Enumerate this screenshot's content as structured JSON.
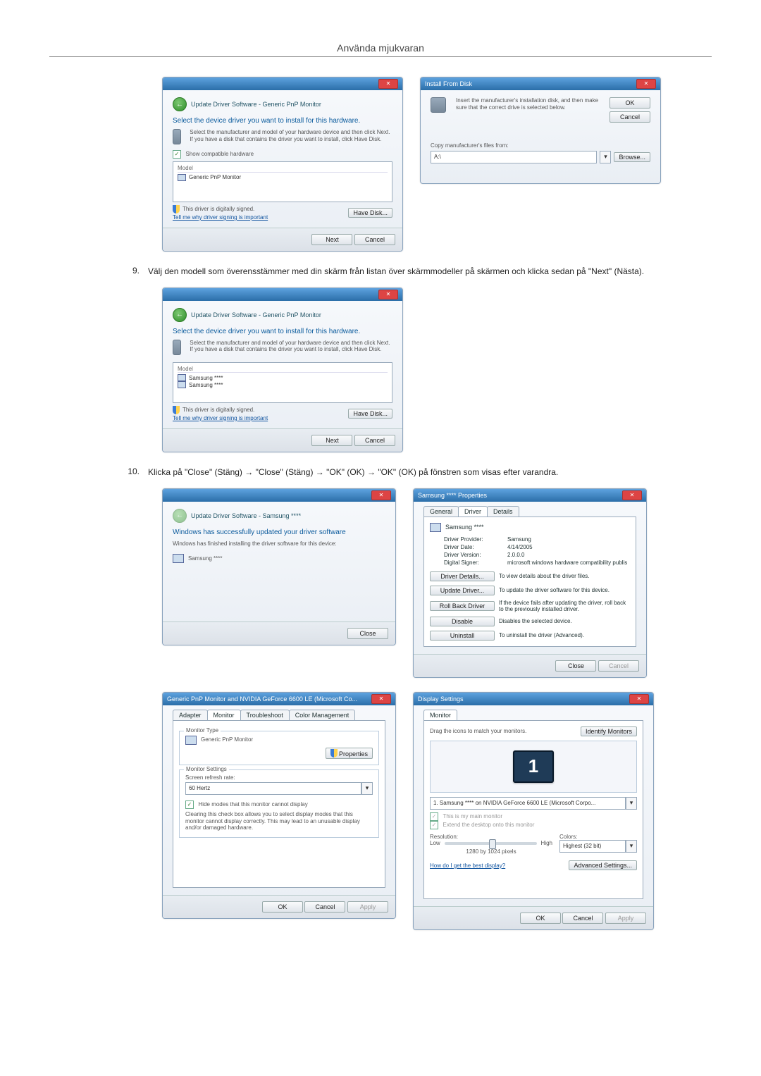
{
  "page_title": "Använda mjukvaran",
  "step9": {
    "num": "9.",
    "text": "Välj den modell som överensstämmer med din skärm från listan över skärmmodeller på skärmen och klicka sedan på \"Next\" (Nästa)."
  },
  "step10": {
    "num": "10.",
    "text": "Klicka på \"Close\" (Stäng) → \"Close\" (Stäng) → \"OK\" (OK) → \"OK\" (OK) på fönstren som visas efter varandra."
  },
  "fig1": {
    "crumb": "Update Driver Software - Generic PnP Monitor",
    "heading": "Select the device driver you want to install for this hardware.",
    "desc": "Select the manufacturer and model of your hardware device and then click Next. If you have a disk that contains the driver you want to install, click Have Disk.",
    "show_compat": "Show compatible hardware",
    "col_model": "Model",
    "item1": "Generic PnP Monitor",
    "signed": "This driver is digitally signed.",
    "tell": "Tell me why driver signing is important",
    "have_disk": "Have Disk...",
    "next": "Next",
    "cancel": "Cancel"
  },
  "fig2": {
    "title": "Install From Disk",
    "desc": "Insert the manufacturer's installation disk, and then make sure that the correct drive is selected below.",
    "ok": "OK",
    "cancel": "Cancel",
    "copy": "Copy manufacturer's files from:",
    "drive": "A:\\",
    "browse": "Browse..."
  },
  "fig3": {
    "crumb": "Update Driver Software - Generic PnP Monitor",
    "heading": "Select the device driver you want to install for this hardware.",
    "desc": "Select the manufacturer and model of your hardware device and then click Next. If you have a disk that contains the driver you want to install, click Have Disk.",
    "col_model": "Model",
    "item1": "Samsung ****",
    "item2": "Samsung ****",
    "signed": "This driver is digitally signed.",
    "tell": "Tell me why driver signing is important",
    "have_disk": "Have Disk...",
    "next": "Next",
    "cancel": "Cancel"
  },
  "fig4": {
    "crumb": "Update Driver Software - Samsung ****",
    "heading": "Windows has successfully updated your driver software",
    "desc": "Windows has finished installing the driver software for this device:",
    "item": "Samsung ****",
    "close": "Close"
  },
  "fig5": {
    "title": "Samsung **** Properties",
    "tabs": {
      "general": "General",
      "driver": "Driver",
      "details": "Details"
    },
    "device": "Samsung ****",
    "rows": {
      "prov_l": "Driver Provider:",
      "prov_v": "Samsung",
      "date_l": "Driver Date:",
      "date_v": "4/14/2005",
      "ver_l": "Driver Version:",
      "ver_v": "2.0.0.0",
      "sig_l": "Digital Signer:",
      "sig_v": "microsoft windows hardware compatibility publis"
    },
    "btns": {
      "details": "Driver Details...",
      "details_d": "To view details about the driver files.",
      "update": "Update Driver...",
      "update_d": "To update the driver software for this device.",
      "rollback": "Roll Back Driver",
      "rollback_d": "If the device fails after updating the driver, roll back to the previously installed driver.",
      "disable": "Disable",
      "disable_d": "Disables the selected device.",
      "uninst": "Uninstall",
      "uninst_d": "To uninstall the driver (Advanced)."
    },
    "close": "Close",
    "cancel": "Cancel"
  },
  "fig6": {
    "title": "Generic PnP Monitor and NVIDIA GeForce 6600 LE (Microsoft Co...",
    "tabs": {
      "adapter": "Adapter",
      "monitor": "Monitor",
      "troubleshoot": "Troubleshoot",
      "cm": "Color Management"
    },
    "mt_label": "Monitor Type",
    "mt_value": "Generic PnP Monitor",
    "props": "Properties",
    "ms_label": "Monitor Settings",
    "refresh_l": "Screen refresh rate:",
    "refresh_v": "60 Hertz",
    "hide": "Hide modes that this monitor cannot display",
    "hide_desc": "Clearing this check box allows you to select display modes that this monitor cannot display correctly. This may lead to an unusable display and/or damaged hardware.",
    "ok": "OK",
    "cancel": "Cancel",
    "apply": "Apply"
  },
  "fig7": {
    "title": "Display Settings",
    "tab": "Monitor",
    "drag": "Drag the icons to match your monitors.",
    "identify": "Identify Monitors",
    "mon1": "1",
    "sel": "1. Samsung **** on NVIDIA GeForce 6600 LE (Microsoft Corpo...",
    "main": "This is my main monitor",
    "extend": "Extend the desktop onto this monitor",
    "res_l": "Resolution:",
    "low": "Low",
    "high": "High",
    "res_v": "1280 by 1024 pixels",
    "col_l": "Colors:",
    "col_v": "Highest (32 bit)",
    "best": "How do I get the best display?",
    "adv": "Advanced Settings...",
    "ok": "OK",
    "cancel": "Cancel",
    "apply": "Apply"
  }
}
